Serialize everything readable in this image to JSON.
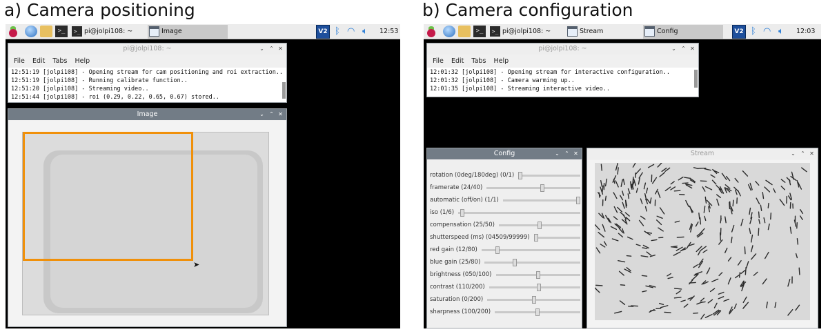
{
  "panel_a": {
    "heading": "a) Camera positioning",
    "taskbar": {
      "task_terminal": "pi@jolpi108: ~",
      "task_image": "Image",
      "vnc": "V2",
      "clock": "12:53"
    },
    "terminal": {
      "title": "pi@jolpi108: ~",
      "menu": [
        "File",
        "Edit",
        "Tabs",
        "Help"
      ],
      "lines": [
        "12:51:19 [jolpi108] - Opening stream for cam positioning and roi extraction..",
        "12:51:19 [jolpi108] - Running calibrate function..",
        "12:51:20 [jolpi108] - Streaming video..",
        "12:51:44 [jolpi108] - roi (0.29, 0.22, 0.65, 0.67) stored.."
      ]
    },
    "image_window": {
      "title": "Image"
    },
    "roi_color": "#f0900a"
  },
  "panel_b": {
    "heading": "b) Camera configuration",
    "taskbar": {
      "task_terminal": "pi@jolpi108: ~",
      "task_stream": "Stream",
      "task_config": "Config",
      "vnc": "V2",
      "clock": "12:03"
    },
    "terminal": {
      "title": "pi@jolpi108: ~",
      "menu": [
        "File",
        "Edit",
        "Tabs",
        "Help"
      ],
      "lines": [
        "12:01:32 [jolpi108] - Opening stream for interactive configuration..",
        "12:01:32 [jolpi108] - Camera warming up..",
        "12:01:35 [jolpi108] - Streaming interactive video.."
      ]
    },
    "config_window": {
      "title": "Config",
      "sliders": [
        {
          "label": "rotation (0deg/180deg) (0/1)",
          "level": 0.0
        },
        {
          "label": "framerate  (24/40)",
          "level": 0.6
        },
        {
          "label": "automatic (off/on) (1/1)",
          "level": 1.0
        },
        {
          "label": "iso      (1/6)",
          "level": 0.02
        },
        {
          "label": "compensation (25/50)",
          "level": 0.5
        },
        {
          "label": "shutterspeed (ms) (04509/99999)",
          "level": 0.0
        },
        {
          "label": "red gain   (12/80)",
          "level": 0.15
        },
        {
          "label": "blue gain   (25/80)",
          "level": 0.31
        },
        {
          "label": "brightness (050/100)",
          "level": 0.5
        },
        {
          "label": "contrast   (110/200)",
          "level": 0.55
        },
        {
          "label": "saturation (0/200)",
          "level": 0.5
        },
        {
          "label": "sharpness  (100/200)",
          "level": 0.5
        }
      ]
    },
    "stream_window": {
      "title": "Stream"
    }
  },
  "icons": {
    "raspberry": "raspberry-pi-menu-icon",
    "browser": "web-browser-icon",
    "files": "file-manager-icon",
    "terminal": "terminal-icon",
    "bluetooth": "bluetooth-icon",
    "wifi": "wifi-icon",
    "volume": "volume-icon"
  }
}
